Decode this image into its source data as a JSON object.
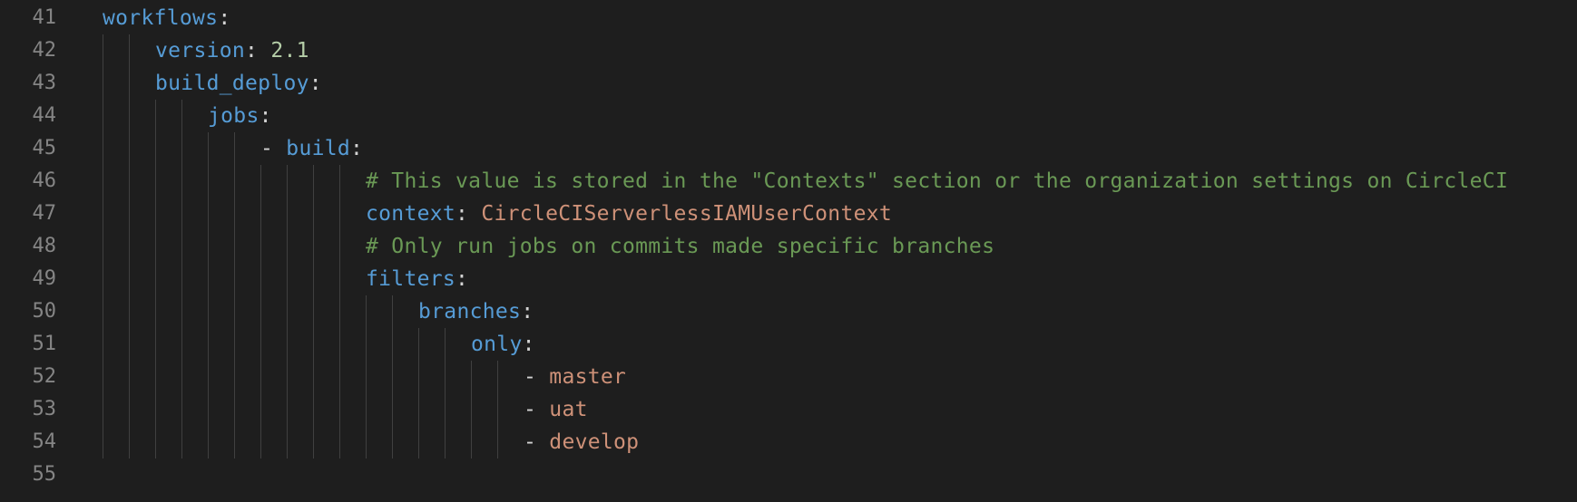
{
  "editor": {
    "colors": {
      "background": "#1e1e1e",
      "line_number": "#858585",
      "key": "#569cd6",
      "punctuation": "#d4d4d4",
      "number": "#b5cea8",
      "string": "#ce9178",
      "comment": "#6a9955",
      "indent_guide": "#404040"
    },
    "lines": [
      {
        "num": "41",
        "indent": 0,
        "tokens": [
          {
            "t": "key",
            "v": "workflows"
          },
          {
            "t": "punc",
            "v": ":"
          }
        ]
      },
      {
        "num": "42",
        "indent": 2,
        "tokens": [
          {
            "t": "key",
            "v": "version"
          },
          {
            "t": "punc",
            "v": ": "
          },
          {
            "t": "num",
            "v": "2.1"
          }
        ]
      },
      {
        "num": "43",
        "indent": 2,
        "tokens": [
          {
            "t": "key",
            "v": "build_deploy"
          },
          {
            "t": "punc",
            "v": ":"
          }
        ]
      },
      {
        "num": "44",
        "indent": 4,
        "tokens": [
          {
            "t": "key",
            "v": "jobs"
          },
          {
            "t": "punc",
            "v": ":"
          }
        ]
      },
      {
        "num": "45",
        "indent": 6,
        "tokens": [
          {
            "t": "punc",
            "v": "- "
          },
          {
            "t": "key",
            "v": "build"
          },
          {
            "t": "punc",
            "v": ":"
          }
        ]
      },
      {
        "num": "46",
        "indent": 10,
        "tokens": [
          {
            "t": "cmt",
            "v": "# This value is stored in the \"Contexts\" section or the organization settings on CircleCI"
          }
        ]
      },
      {
        "num": "47",
        "indent": 10,
        "tokens": [
          {
            "t": "key",
            "v": "context"
          },
          {
            "t": "punc",
            "v": ": "
          },
          {
            "t": "str",
            "v": "CircleCIServerlessIAMUserContext"
          }
        ]
      },
      {
        "num": "48",
        "indent": 10,
        "tokens": [
          {
            "t": "cmt",
            "v": "# Only run jobs on commits made specific branches"
          }
        ]
      },
      {
        "num": "49",
        "indent": 10,
        "tokens": [
          {
            "t": "key",
            "v": "filters"
          },
          {
            "t": "punc",
            "v": ":"
          }
        ]
      },
      {
        "num": "50",
        "indent": 12,
        "tokens": [
          {
            "t": "key",
            "v": "branches"
          },
          {
            "t": "punc",
            "v": ":"
          }
        ]
      },
      {
        "num": "51",
        "indent": 14,
        "tokens": [
          {
            "t": "key",
            "v": "only"
          },
          {
            "t": "punc",
            "v": ":"
          }
        ]
      },
      {
        "num": "52",
        "indent": 16,
        "tokens": [
          {
            "t": "punc",
            "v": "- "
          },
          {
            "t": "str",
            "v": "master"
          }
        ]
      },
      {
        "num": "53",
        "indent": 16,
        "tokens": [
          {
            "t": "punc",
            "v": "- "
          },
          {
            "t": "str",
            "v": "uat"
          }
        ]
      },
      {
        "num": "54",
        "indent": 16,
        "tokens": [
          {
            "t": "punc",
            "v": "- "
          },
          {
            "t": "str",
            "v": "develop"
          }
        ]
      },
      {
        "num": "55",
        "indent": 0,
        "tokens": []
      }
    ]
  }
}
